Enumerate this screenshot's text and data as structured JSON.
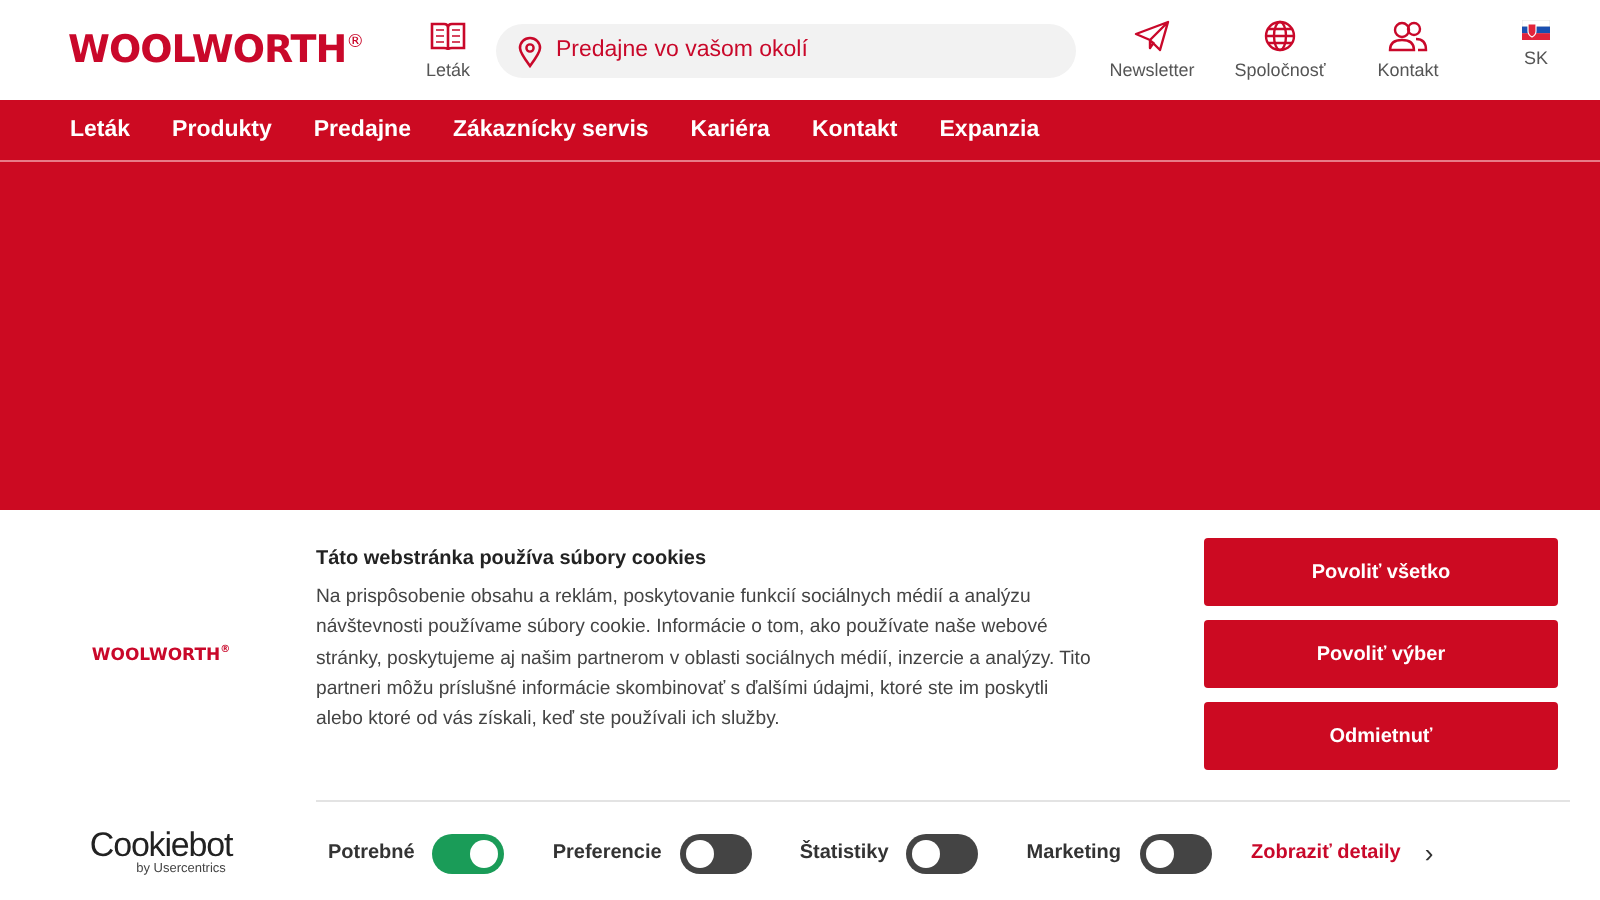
{
  "header": {
    "logo": "WOOLWORTH$^{®}$",
    "flyer_label": "Leták",
    "search": {
      "placeholder": "Predajne vo vašom okolí"
    },
    "actions": [
      {
        "kind": "newsletter",
        "label": "Newsletter"
      },
      {
        "kind": "globe",
        "label": "Spoločnosť"
      },
      {
        "kind": "people",
        "label": "Kontakt"
      },
      {
        "kind": "flag",
        "label": "SK"
      }
    ]
  },
  "nav": [
    "Leták",
    "Produkty",
    "Predajne",
    "Zákaznícky servis",
    "Kariéra",
    "Kontakt",
    "Expanzia"
  ],
  "cookie_dialog": {
    "logo": "WOOLWORTH$^{®}$",
    "title": "Táto webstránka používa súbory cookies",
    "body": "Na prispôsobenie obsahu a reklám, poskytovanie funkcií sociálnych médií a analýzu návštevnosti používame súbory cookie. Informácie o tom, ako používate naše webové stránky, poskytujeme aj našim partnerom v oblasti sociálnych médií, inzercie a analýzy. Tito partneri môžu príslušné informácie skombinovať s ďalšími údajmi, ktoré ste im poskytli alebo ktoré od vás získali, keď ste používali ich služby.",
    "buttons": [
      "Povoliť všetko",
      "Povoliť výber",
      "Odmietnuť"
    ],
    "provider": {
      "name": "Cookiebot",
      "by": "by Usercentrics"
    },
    "toggles": [
      {
        "label": "Potrebné",
        "on": true
      },
      {
        "label": "Preferencie",
        "on": false
      },
      {
        "label": "Štatistiky",
        "on": false
      },
      {
        "label": "Marketing",
        "on": false
      }
    ],
    "details_link": "Zobraziť detaily",
    "details_icon": "›"
  }
}
